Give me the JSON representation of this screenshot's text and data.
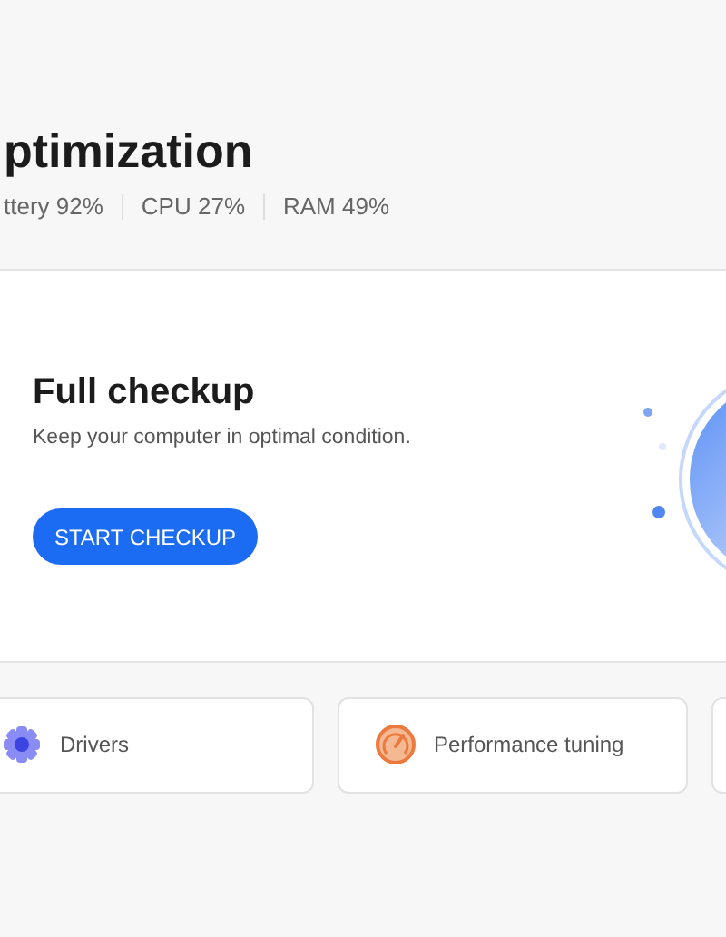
{
  "header": {
    "title": "ptimization",
    "stats": [
      "ttery 92%",
      "CPU 27%",
      "RAM 49%"
    ]
  },
  "checkup_card": {
    "title": "Full checkup",
    "description": "Keep your computer in optimal condition.",
    "button": "START CHECKUP"
  },
  "tools": [
    {
      "kind": "drivers",
      "label": "Drivers"
    },
    {
      "kind": "performance",
      "label": "Performance tuning"
    },
    {
      "kind": "blank"
    }
  ]
}
